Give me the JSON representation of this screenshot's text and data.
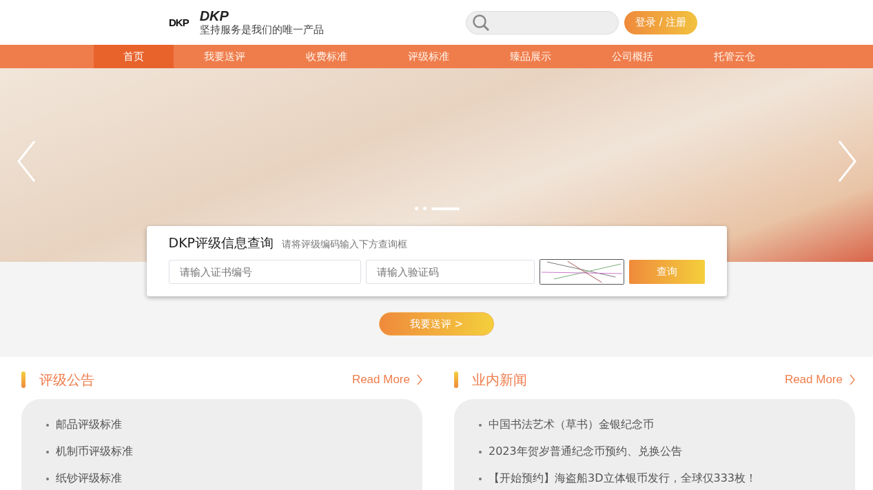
{
  "header": {
    "logo_mark": "DKP",
    "brand": "DKP",
    "slogan": "坚持服务是我们的唯一产品",
    "login_button": "登录 / 注册"
  },
  "nav": [
    {
      "label": "首页",
      "selected": true
    },
    {
      "label": "我要送评",
      "selected": false
    },
    {
      "label": "收费标准",
      "selected": false
    },
    {
      "label": "评级标准",
      "selected": false
    },
    {
      "label": "臻品展示",
      "selected": false
    },
    {
      "label": "公司概括",
      "selected": false
    },
    {
      "label": "托管云仓",
      "selected": false
    }
  ],
  "banner": {
    "slides": [
      {
        "selected": false
      },
      {
        "selected": false
      },
      {
        "selected": true
      }
    ]
  },
  "query": {
    "title": "DKP评级信息查询",
    "hint": "请将评级编码输入下方查询框",
    "cert_field": {
      "placeholder": "请输入证书编号"
    },
    "captcha_field": {
      "placeholder": "请输入验证码"
    },
    "button": "查询"
  },
  "submit_button": "我要送评 >",
  "sections": [
    {
      "title": "评级公告",
      "more": "Read More",
      "items": [
        "邮品评级标准",
        "机制币评级标准",
        "纸钞评级标准"
      ]
    },
    {
      "title": "业内新闻",
      "more": "Read More",
      "items": [
        "中国书法艺术（草书）金银纪念币",
        "2023年贺岁普通纪念币预约、兑换公告",
        "【开始预约】海盗船3D立体银币发行，全球仅333枚！"
      ]
    }
  ]
}
